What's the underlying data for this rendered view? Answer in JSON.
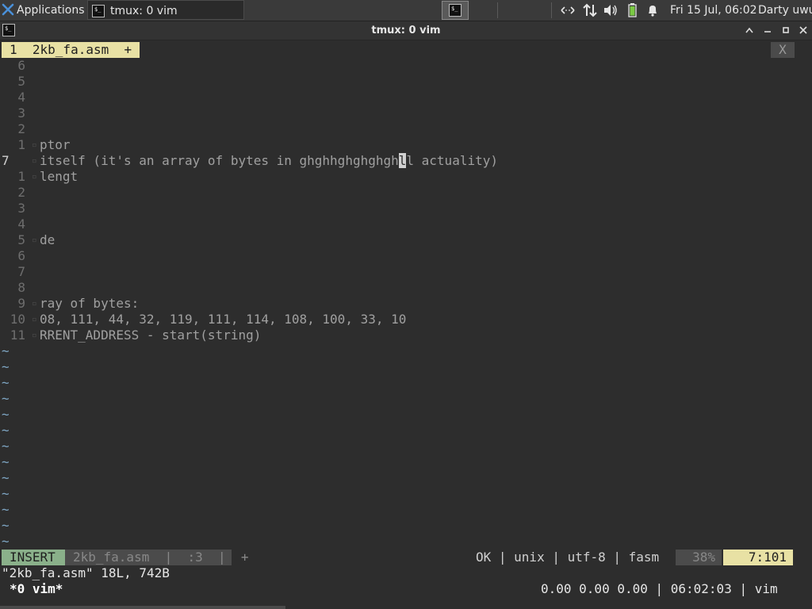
{
  "panel": {
    "apps_label": "Applications",
    "task_title": "tmux: 0 vim",
    "clock": "Fri 15 Jul, 06:02",
    "user": "Darty uwu",
    "icons": {
      "apps": "xfce-mouse-icon",
      "net": "network-arrows-icon",
      "updown": "transfer-arrows-icon",
      "volume": "speaker-icon",
      "battery": "battery-icon",
      "bell": "notification-bell-icon"
    }
  },
  "window": {
    "title": "tmux: 0 vim"
  },
  "vim": {
    "tab_label": "1  2kb_fa.asm  +",
    "tab_close": "X",
    "lines": [
      {
        "num": "6",
        "text": ""
      },
      {
        "num": "5",
        "text": ""
      },
      {
        "num": "4",
        "text": ""
      },
      {
        "num": "3",
        "text": ""
      },
      {
        "num": "2",
        "text": ""
      },
      {
        "num": "1",
        "text": "ptor"
      },
      {
        "num": "7",
        "text": "itself (it's an array of bytes in ghghhghghghgh",
        "cursor": "l",
        "after": "l actuality)",
        "current": true
      },
      {
        "num": "1",
        "text": "lengt"
      },
      {
        "num": "2",
        "text": ""
      },
      {
        "num": "3",
        "text": ""
      },
      {
        "num": "4",
        "text": ""
      },
      {
        "num": "5",
        "text": "de"
      },
      {
        "num": "6",
        "text": ""
      },
      {
        "num": "7",
        "text": ""
      },
      {
        "num": "8",
        "text": ""
      },
      {
        "num": "9",
        "text": "ray of bytes:"
      },
      {
        "num": "10",
        "text": "08, 111, 44, 32, 119, 111, 114, 108, 100, 33, 10"
      },
      {
        "num": "11",
        "text": "RRENT_ADDRESS - start(string)"
      }
    ],
    "tildes": 13,
    "tilde_char": "~",
    "status": {
      "mode": "INSERT",
      "file": "2kb_fa.asm  |  :3  |  +",
      "right": "OK | unix | utf-8 | fasm",
      "percent": "38%",
      "position": "7:101"
    },
    "message": "\"2kb_fa.asm\" 18L, 742B"
  },
  "tmux": {
    "left": "*0 vim*",
    "right": "0.00 0.00 0.00 | 06:02:03 | vim"
  }
}
